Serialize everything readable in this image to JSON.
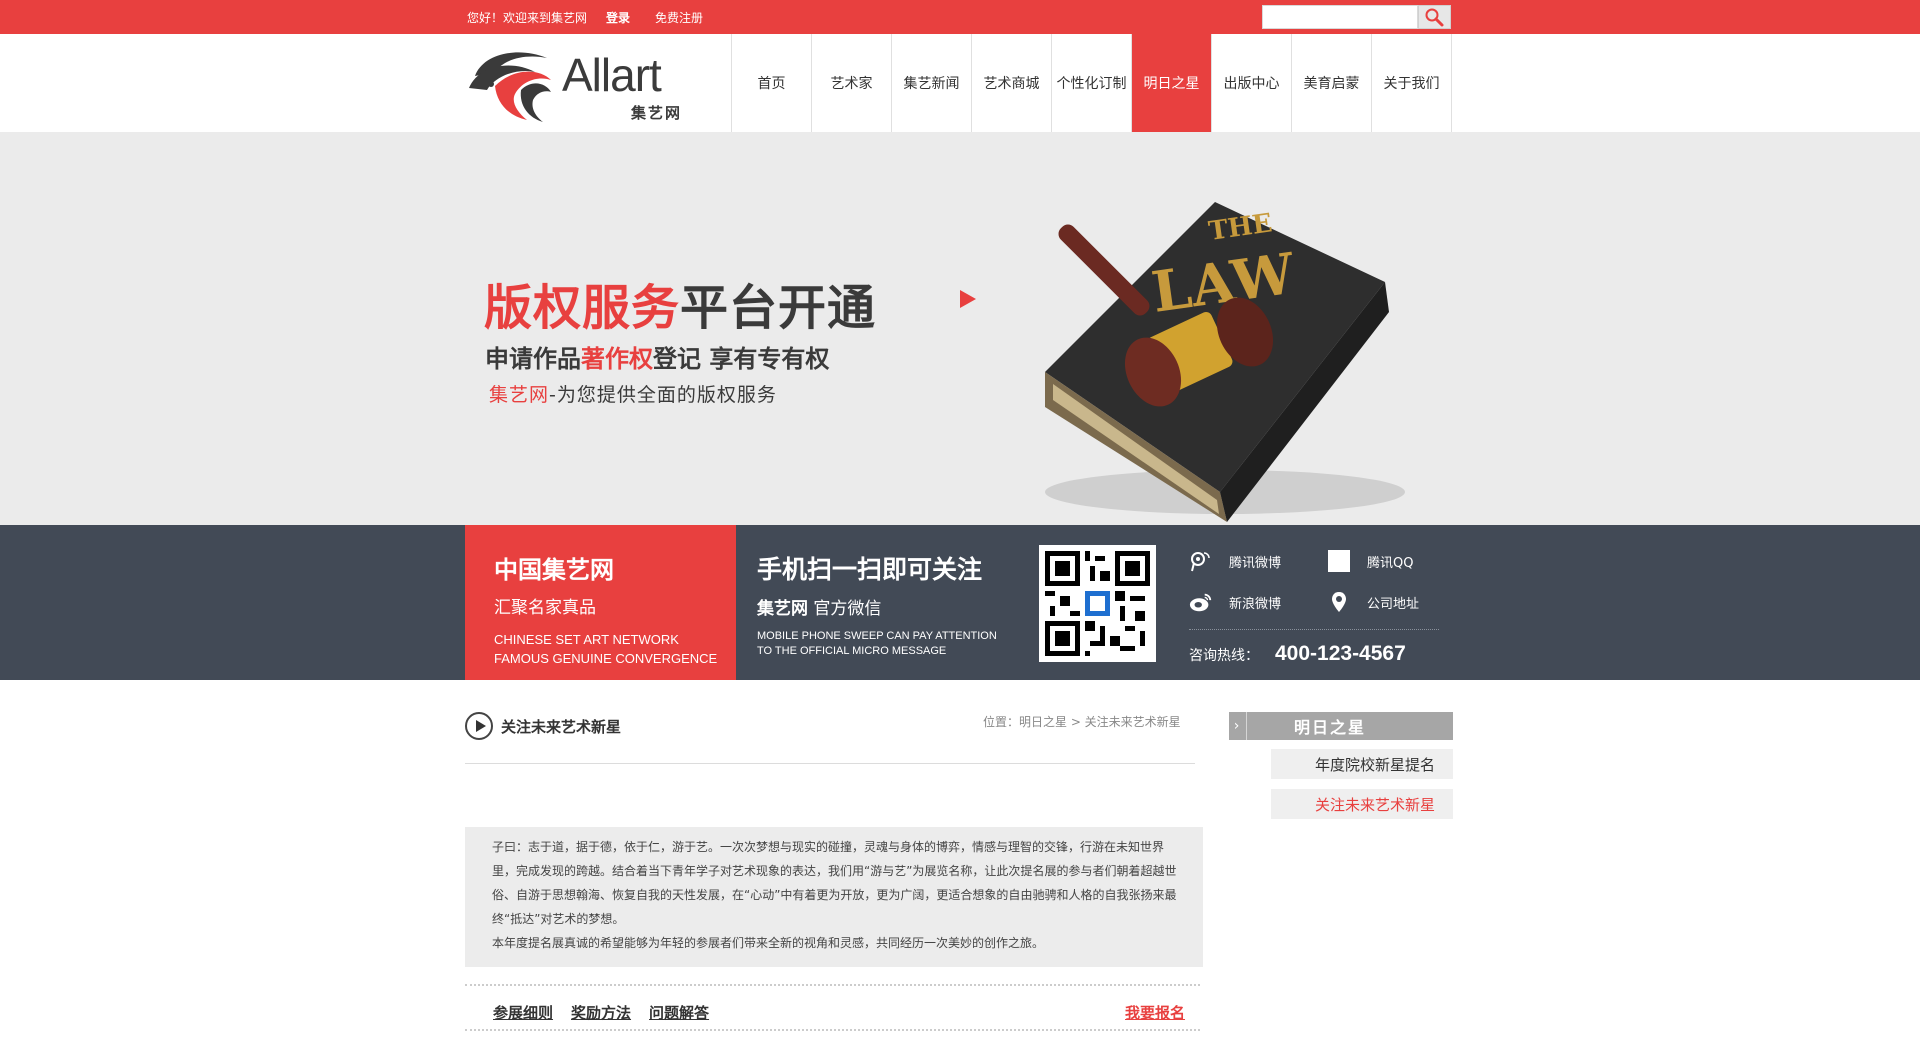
{
  "topbar": {
    "welcome": "您好！欢迎来到集艺网",
    "login": "登录",
    "register": "免费注册",
    "search_placeholder": ""
  },
  "logo": {
    "text": "Allart",
    "sub": "集艺网"
  },
  "nav": {
    "items": [
      "首页",
      "艺术家",
      "集艺新闻",
      "艺术商城",
      "个性化订制",
      "明日之星",
      "出版中心",
      "美育启蒙",
      "关于我们"
    ],
    "active": "明日之星"
  },
  "banner": {
    "title_red": "版权服务",
    "title_dark": "平台开通",
    "line2_a": "申请作品",
    "line2_red": "著作权",
    "line2_b": "登记 享有专有权",
    "line3_red": "集艺网",
    "line3_rest": "-为您提供全面的版权服务",
    "book_text": "THE LAW"
  },
  "strip": {
    "red_title": "中国集艺网",
    "red_sub": "汇聚名家真品",
    "red_en1": "CHINESE SET ART NETWORK",
    "red_en2": "FAMOUS GENUINE CONVERGENCE",
    "scan_title": "手机扫一扫即可关注",
    "scan_brand": "集艺网",
    "scan_sub": "官方微信",
    "scan_en1": "MOBILE PHONE SWEEP CAN PAY ATTENTION",
    "scan_en2": "TO THE OFFICIAL MICRO MESSAGE",
    "social": {
      "weibo": "腾讯微博",
      "qq": "腾讯QQ",
      "sina": "新浪微博",
      "address": "公司地址"
    },
    "hotline_label": "咨询热线：",
    "hotline_number": "400-123-4567"
  },
  "content": {
    "title": "关注未来艺术新星",
    "breadcrumb": "位置：明日之星 > 关注未来艺术新星",
    "intro_p1": "子曰：志于道，据于德，依于仁，游于艺。一次次梦想与现实的碰撞，灵魂与身体的博弈，情感与理智的交锋，行游在未知世界里，完成发现的跨越。结合着当下青年学子对艺术现象的表达，我们用“游与艺”为展览名称，让此次提名展的参与者们朝着超越世俗、自游于思想翰海、恢复自我的天性发展，在“心动”中有着更为开放，更为广阔，更适合想象的自由驰骋和人格的自我张扬来最终“抵达”对艺术的梦想。",
    "intro_p2": "本年度提名展真诚的希望能够为年轻的参展者们带来全新的视角和灵感，共同经历一次美妙的创作之旅。",
    "tabs": [
      "参展细则",
      "奖励方法",
      "问题解答"
    ],
    "signup": "我要报名"
  },
  "sidebar": {
    "heading": "明日之星",
    "items": [
      "年度院校新星提名",
      "关注未来艺术新星"
    ],
    "active": "关注未来艺术新星"
  },
  "colors": {
    "accent": "#e8403f",
    "strip_dark": "#424a56",
    "banner_bg": "#ebebeb"
  }
}
